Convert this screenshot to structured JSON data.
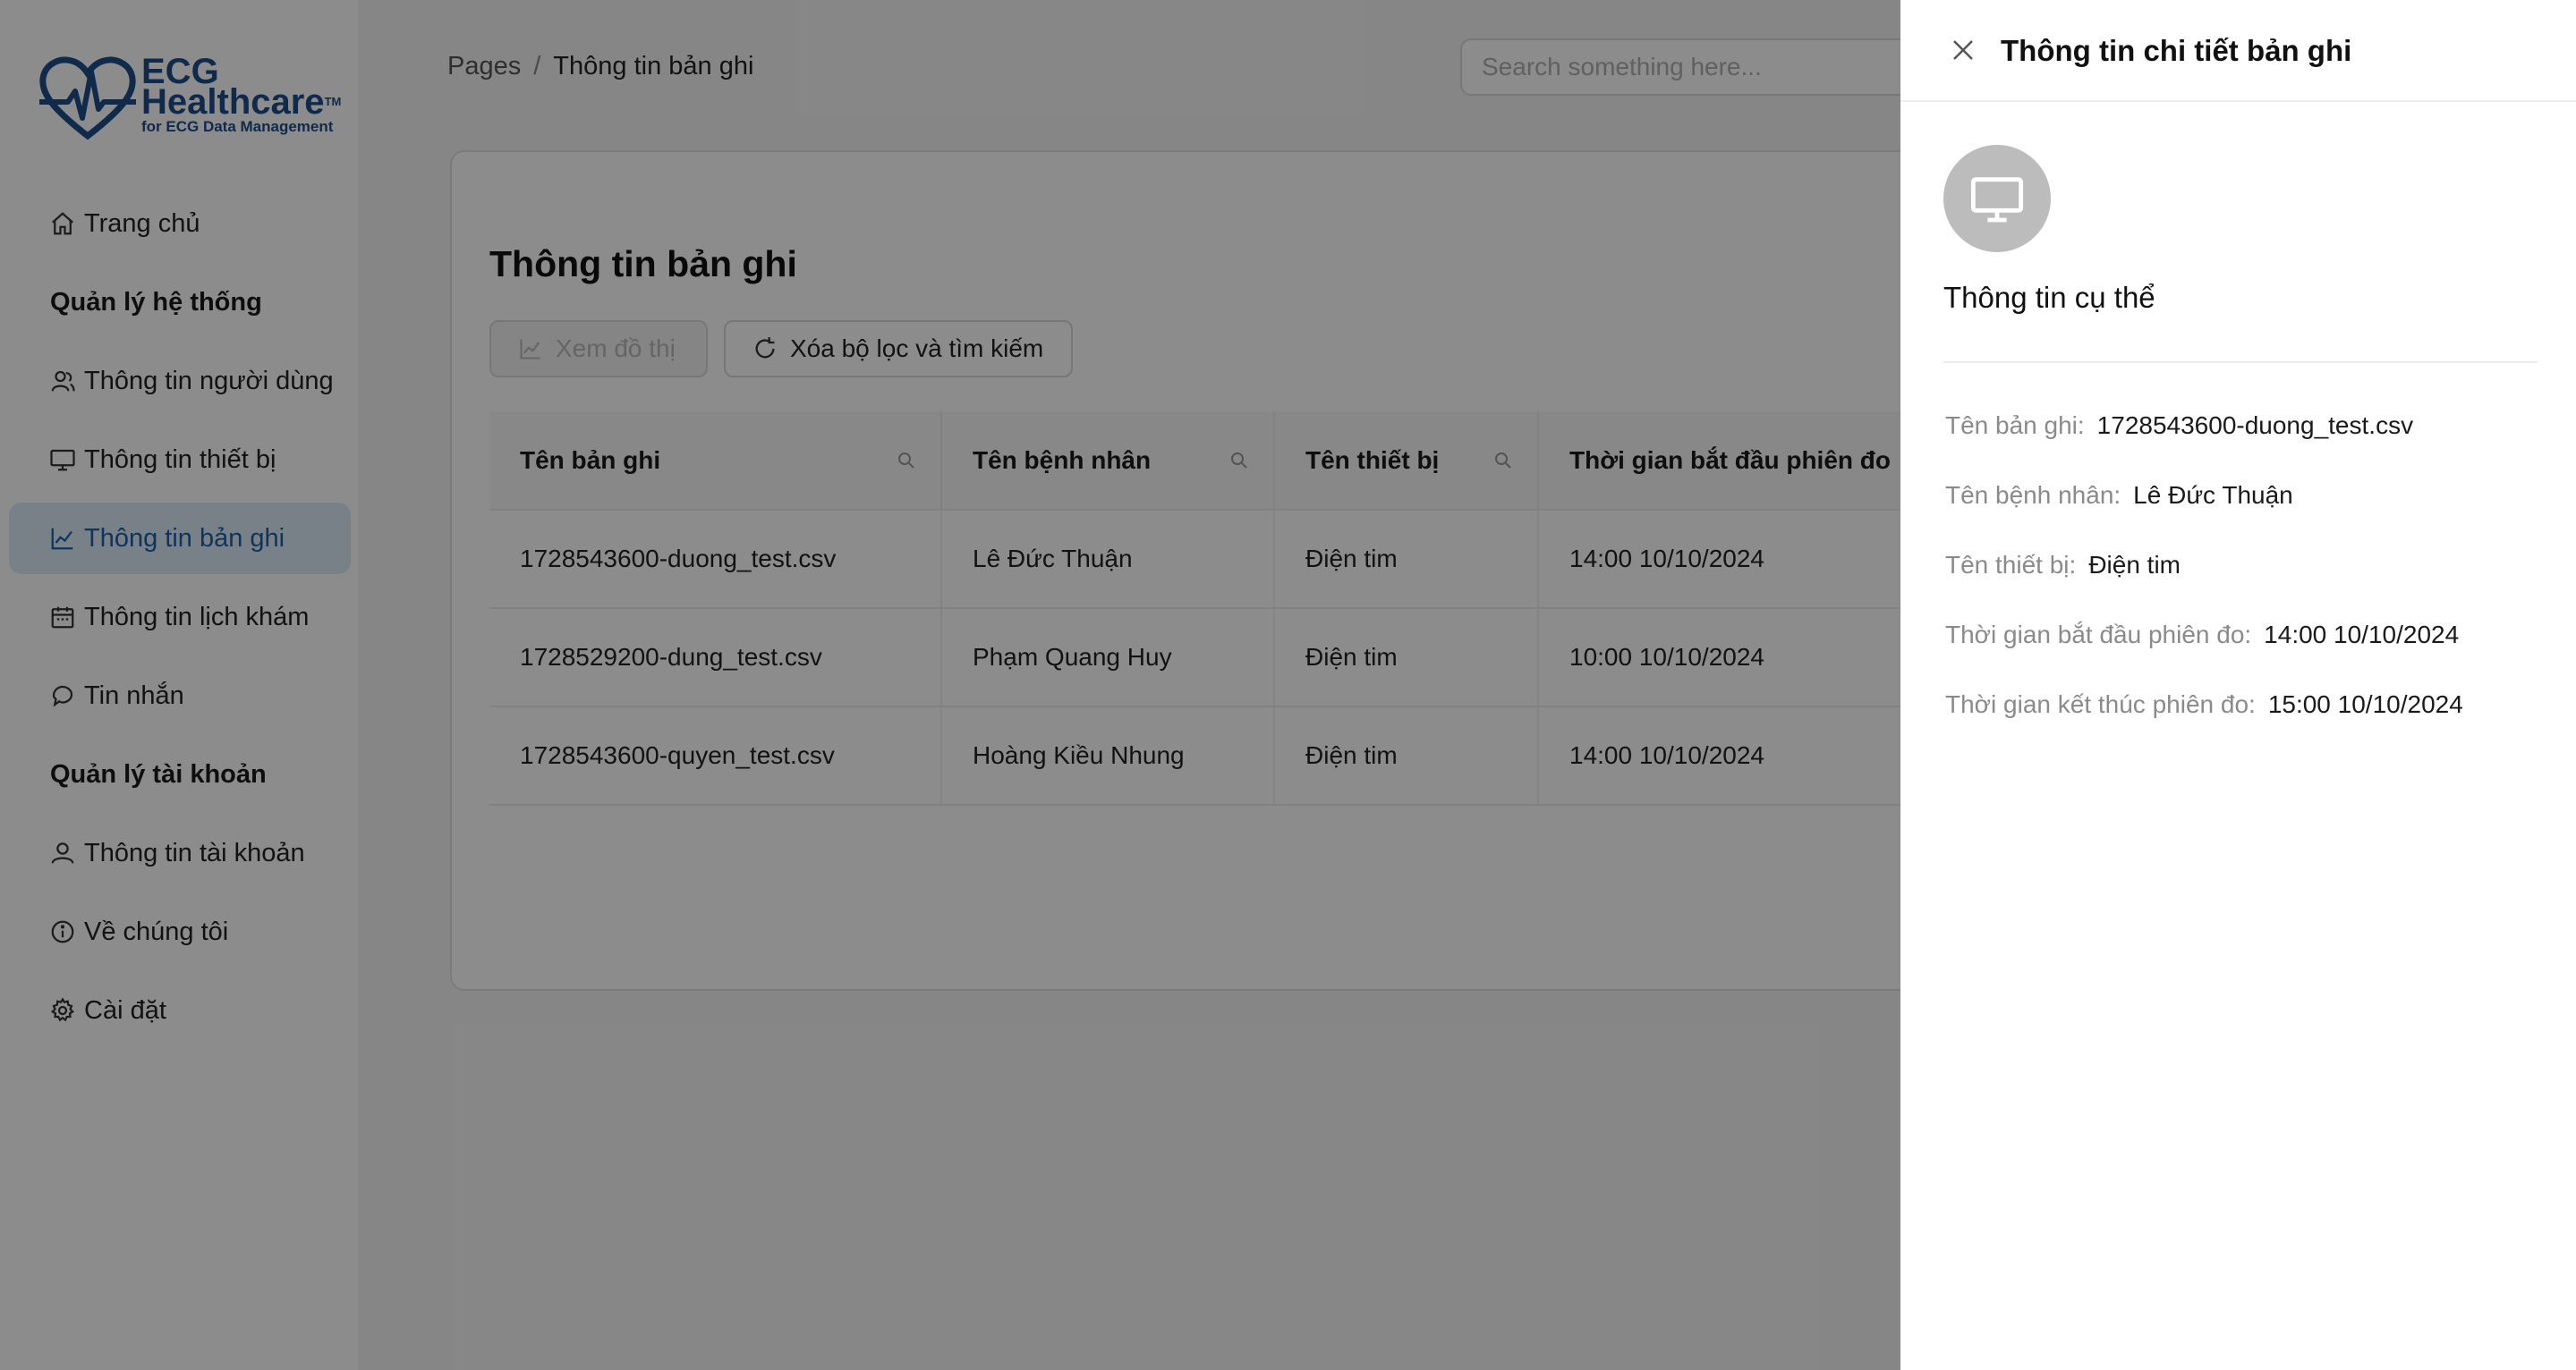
{
  "brand": {
    "line1": "ECG",
    "line2": "Healthcare",
    "tm": "TM",
    "tagline": "for ECG Data Management"
  },
  "sidebar": {
    "items": [
      {
        "label": "Trang chủ",
        "icon": "home-icon"
      },
      {
        "group": "Quản lý hệ thống"
      },
      {
        "label": "Thông tin người dùng",
        "icon": "users-icon"
      },
      {
        "label": "Thông tin thiết bị",
        "icon": "monitor-icon"
      },
      {
        "label": "Thông tin bản ghi",
        "icon": "line-chart-icon",
        "active": true
      },
      {
        "label": "Thông tin lịch khám",
        "icon": "calendar-icon"
      },
      {
        "label": "Tin nhắn",
        "icon": "message-icon"
      },
      {
        "group": "Quản lý tài khoản"
      },
      {
        "label": "Thông tin tài khoản",
        "icon": "user-icon"
      },
      {
        "label": "Về chúng tôi",
        "icon": "info-icon"
      },
      {
        "label": "Cài đặt",
        "icon": "gear-icon"
      }
    ]
  },
  "header": {
    "breadcrumb": [
      "Pages",
      "/",
      "Thông tin bản ghi"
    ],
    "search_placeholder": "Search something here..."
  },
  "main": {
    "title": "Thông tin bản ghi",
    "btn_graph": "Xem đồ thị",
    "btn_reset": "Xóa bộ lọc và tìm kiếm",
    "columns": [
      "Tên bản ghi",
      "Tên bệnh nhân",
      "Tên thiết bị",
      "Thời gian bắt đầu phiên đo"
    ],
    "rows": [
      [
        "1728543600-duong_test.csv",
        "Lê Đức Thuận",
        "Điện tim",
        "14:00 10/10/2024"
      ],
      [
        "1728529200-dung_test.csv",
        "Phạm Quang Huy",
        "Điện tim",
        "10:00 10/10/2024"
      ],
      [
        "1728543600-quyen_test.csv",
        "Hoàng Kiều Nhung",
        "Điện tim",
        "14:00 10/10/2024"
      ]
    ]
  },
  "drawer": {
    "title": "Thông tin chi tiết bản ghi",
    "subtitle": "Thông tin cụ thể",
    "details": [
      {
        "label": "Tên bản ghi:",
        "value": "1728543600-duong_test.csv"
      },
      {
        "label": "Tên bệnh nhân:",
        "value": "Lê Đức Thuận"
      },
      {
        "label": "Tên thiết bị:",
        "value": "Điện tim"
      },
      {
        "label": "Thời gian bắt đầu phiên đo:",
        "value": "14:00 10/10/2024"
      },
      {
        "label": "Thời gian kết thúc phiên đo:",
        "value": "15:00 10/10/2024"
      }
    ]
  },
  "colors": {
    "brand": "#1d4e89",
    "active_bg": "#dbe9f7",
    "active_text": "#1f5fa8",
    "overlay": "rgba(0,0,0,0.45)",
    "avatar_bg": "#bcbcbc"
  }
}
